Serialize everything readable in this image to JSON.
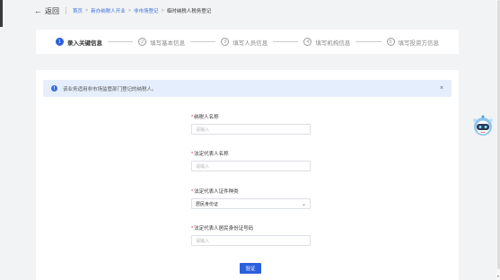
{
  "header": {
    "back_label": "返回",
    "breadcrumbs": [
      "首页",
      "新办纳税人开业",
      "非市场登记"
    ],
    "current": "临时纳税人税务登记"
  },
  "steps": [
    {
      "num": "1",
      "label": "录入关键信息",
      "active": true
    },
    {
      "num": "2",
      "label": "填写基本信息",
      "active": false
    },
    {
      "num": "3",
      "label": "填写人员信息",
      "active": false
    },
    {
      "num": "4",
      "label": "填写机构信息",
      "active": false
    },
    {
      "num": "5",
      "label": "填写投资方信息",
      "active": false
    }
  ],
  "alert": {
    "icon": "!",
    "text": "该业务适用非市场监管部门登记的纳税人。",
    "close": "×"
  },
  "form": {
    "fields": [
      {
        "label": "纳税人名称",
        "placeholder": "请输入",
        "value": ""
      },
      {
        "label": "法定代表人名称",
        "placeholder": "请输入",
        "value": ""
      },
      {
        "label": "法定代表人证件种类",
        "value": "居民身份证"
      },
      {
        "label": "法定代表人居民身份证号码",
        "placeholder": "请输入",
        "value": ""
      }
    ],
    "required_mark": "*",
    "select_chevron": "⌄",
    "submit_label": "验证"
  },
  "colors": {
    "primary": "#2a5fde",
    "alert_bg": "#e5eefc",
    "page_bg": "#f2f3f5",
    "required": "#e23"
  },
  "icons": {
    "back": "arrow-left-icon",
    "alert": "info-icon",
    "close": "close-icon",
    "assistant": "robot-assistant-icon"
  }
}
